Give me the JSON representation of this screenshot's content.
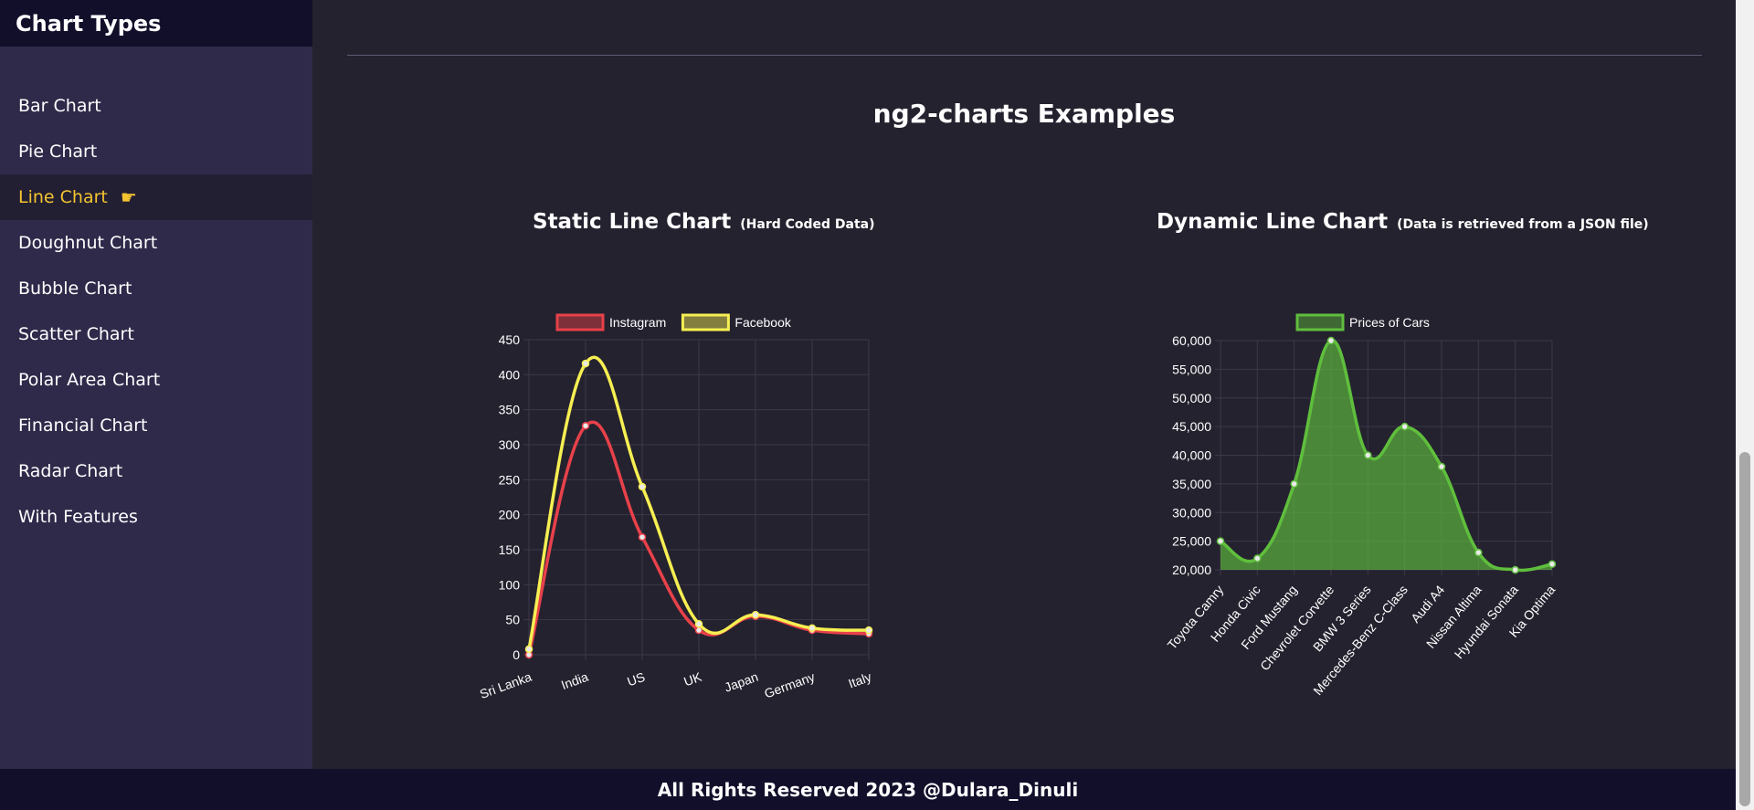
{
  "sidebar": {
    "title": "Chart Types",
    "items": [
      {
        "label": "Bar Chart"
      },
      {
        "label": "Pie Chart"
      },
      {
        "label": "Line Chart",
        "active": true
      },
      {
        "label": "Doughnut Chart"
      },
      {
        "label": "Bubble Chart"
      },
      {
        "label": "Scatter Chart"
      },
      {
        "label": "Polar Area Chart"
      },
      {
        "label": "Financial Chart"
      },
      {
        "label": "Radar Chart"
      },
      {
        "label": "With Features"
      }
    ]
  },
  "main": {
    "title": "ng2-charts Examples",
    "static_title": "Static Line Chart",
    "static_note": "(Hard Coded Data)",
    "dynamic_title": "Dynamic Line Chart",
    "dynamic_note": "(Data is retrieved from a JSON file)"
  },
  "footer": {
    "text": "All Rights Reserved 2023 @Dulara_Dinuli"
  },
  "icons": {
    "active_pointer": "pointing-hand-icon"
  },
  "colors": {
    "active": "#f4c430",
    "instagram": "#e8414a",
    "facebook": "#f6ef52",
    "cars": "#5fbf3d"
  },
  "chart_data": [
    {
      "type": "line",
      "categories": [
        "Sri Lanka",
        "India",
        "US",
        "UK",
        "Japan",
        "Germany",
        "Italy"
      ],
      "series": [
        {
          "name": "Instagram",
          "values": [
            0,
            327,
            168,
            35,
            55,
            35,
            30
          ],
          "color": "#e8414a"
        },
        {
          "name": "Facebook",
          "values": [
            8,
            416,
            240,
            44,
            57,
            38,
            35
          ],
          "color": "#f6ef52"
        }
      ],
      "ylim": [
        0,
        450
      ],
      "yticks": [
        0,
        50,
        100,
        150,
        200,
        250,
        300,
        350,
        400,
        450
      ],
      "grid": true,
      "legend": "top"
    },
    {
      "type": "area",
      "categories": [
        "Toyota Camry",
        "Honda Civic",
        "Ford Mustang",
        "Chevrolet Corvette",
        "BMW 3 Series",
        "Mercedes-Benz C-Class",
        "Audi A4",
        "Nissan Altima",
        "Hyundai Sonata",
        "Kia Optima"
      ],
      "series": [
        {
          "name": "Prices of Cars",
          "values": [
            25000,
            22000,
            35000,
            60000,
            40000,
            45000,
            38000,
            23000,
            20000,
            21000
          ],
          "color": "#5fbf3d"
        }
      ],
      "ylim": [
        20000,
        60000
      ],
      "yticks": [
        "20,000",
        "25,000",
        "30,000",
        "35,000",
        "40,000",
        "45,000",
        "50,000",
        "55,000",
        "60,000"
      ],
      "grid": true,
      "legend": "top"
    }
  ]
}
